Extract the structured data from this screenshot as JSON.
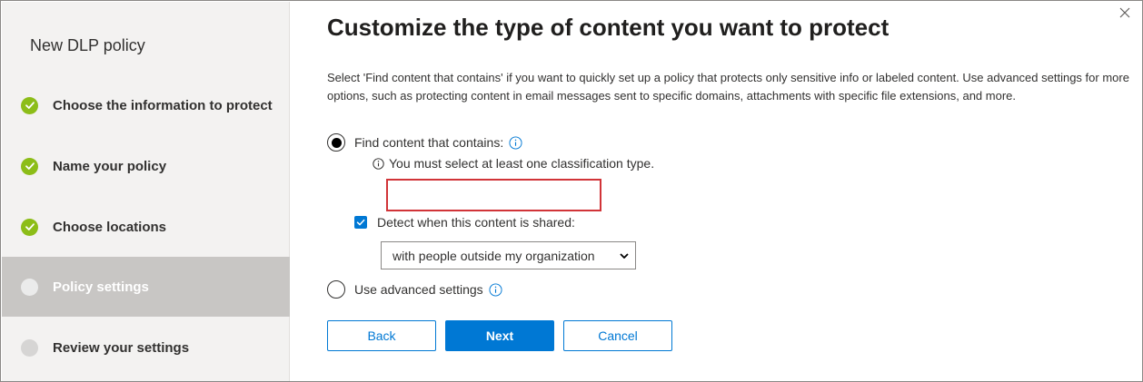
{
  "wizard": {
    "title": "New DLP policy",
    "steps": [
      {
        "label": "Choose the information to protect",
        "status": "done"
      },
      {
        "label": "Name your policy",
        "status": "done"
      },
      {
        "label": "Choose locations",
        "status": "done"
      },
      {
        "label": "Policy settings",
        "status": "current"
      },
      {
        "label": "Review your settings",
        "status": "pending"
      }
    ]
  },
  "page": {
    "title": "Customize the type of content you want to protect",
    "description": "Select 'Find content that contains' if you want to quickly set up a policy that protects only sensitive info or labeled content. Use advanced settings for more options, such as protecting content in email messages sent to specific domains, attachments with specific file extensions, and more."
  },
  "options": {
    "find_content_label": "Find content that contains:",
    "validation_message": "You must select at least one classification type.",
    "classification_value": "",
    "detect_shared_label": "Detect when this content is shared:",
    "detect_shared_checked": true,
    "shared_with_selected": "with people outside my organization",
    "advanced_label": "Use advanced settings",
    "selected_option": "find_content"
  },
  "buttons": {
    "back": "Back",
    "next": "Next",
    "cancel": "Cancel"
  },
  "colors": {
    "accent": "#0078d4",
    "done": "#8cbd18",
    "error": "#d13438",
    "sidebar_bg": "#f3f2f1",
    "current_step_bg": "#c8c6c4"
  },
  "icons": {
    "close": "close-icon",
    "info": "info-icon",
    "check": "checkmark-icon",
    "dropdown": "chevron-down-icon"
  }
}
